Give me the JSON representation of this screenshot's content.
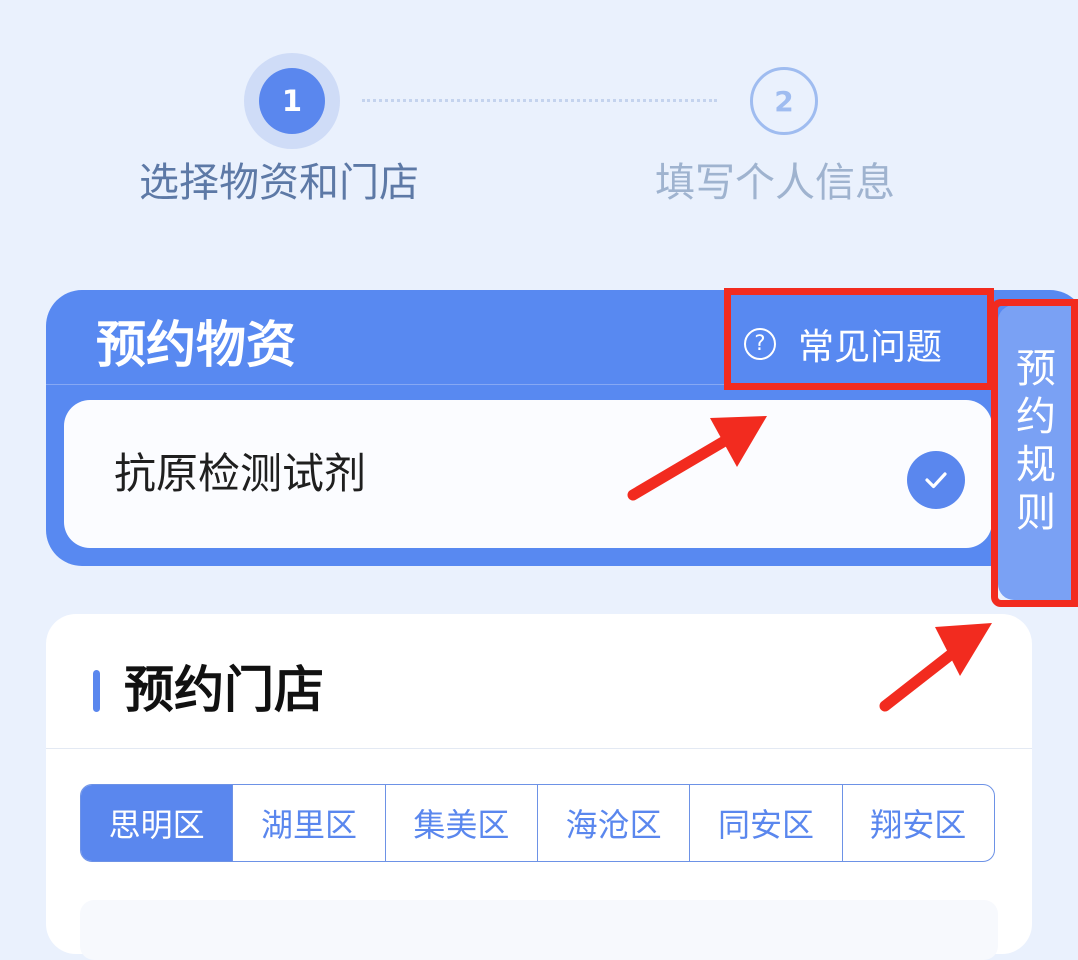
{
  "stepper": {
    "step1": {
      "number": "1",
      "label": "选择物资和门店"
    },
    "step2": {
      "number": "2",
      "label": "填写个人信息"
    }
  },
  "supplies": {
    "title": "预约物资",
    "faq": {
      "icon_glyph": "?",
      "label": "常见问题"
    },
    "item": {
      "name": "抗原检测试剂",
      "selected": true
    }
  },
  "rules_tab": {
    "label": "预约规则"
  },
  "store": {
    "title": "预约门店",
    "districts": [
      {
        "label": "思明区",
        "active": true
      },
      {
        "label": "湖里区",
        "active": false
      },
      {
        "label": "集美区",
        "active": false
      },
      {
        "label": "海沧区",
        "active": false
      },
      {
        "label": "同安区",
        "active": false
      },
      {
        "label": "翔安区",
        "active": false
      }
    ]
  },
  "colors": {
    "primary": "#5a87ee",
    "card_blue": "#5889f1",
    "page_bg": "#eaf1fd",
    "annotation_red": "#f22b1f"
  },
  "icons": {
    "faq": "question-circle-icon",
    "item_check": "check-circle-icon",
    "annotation": "red-arrow"
  }
}
